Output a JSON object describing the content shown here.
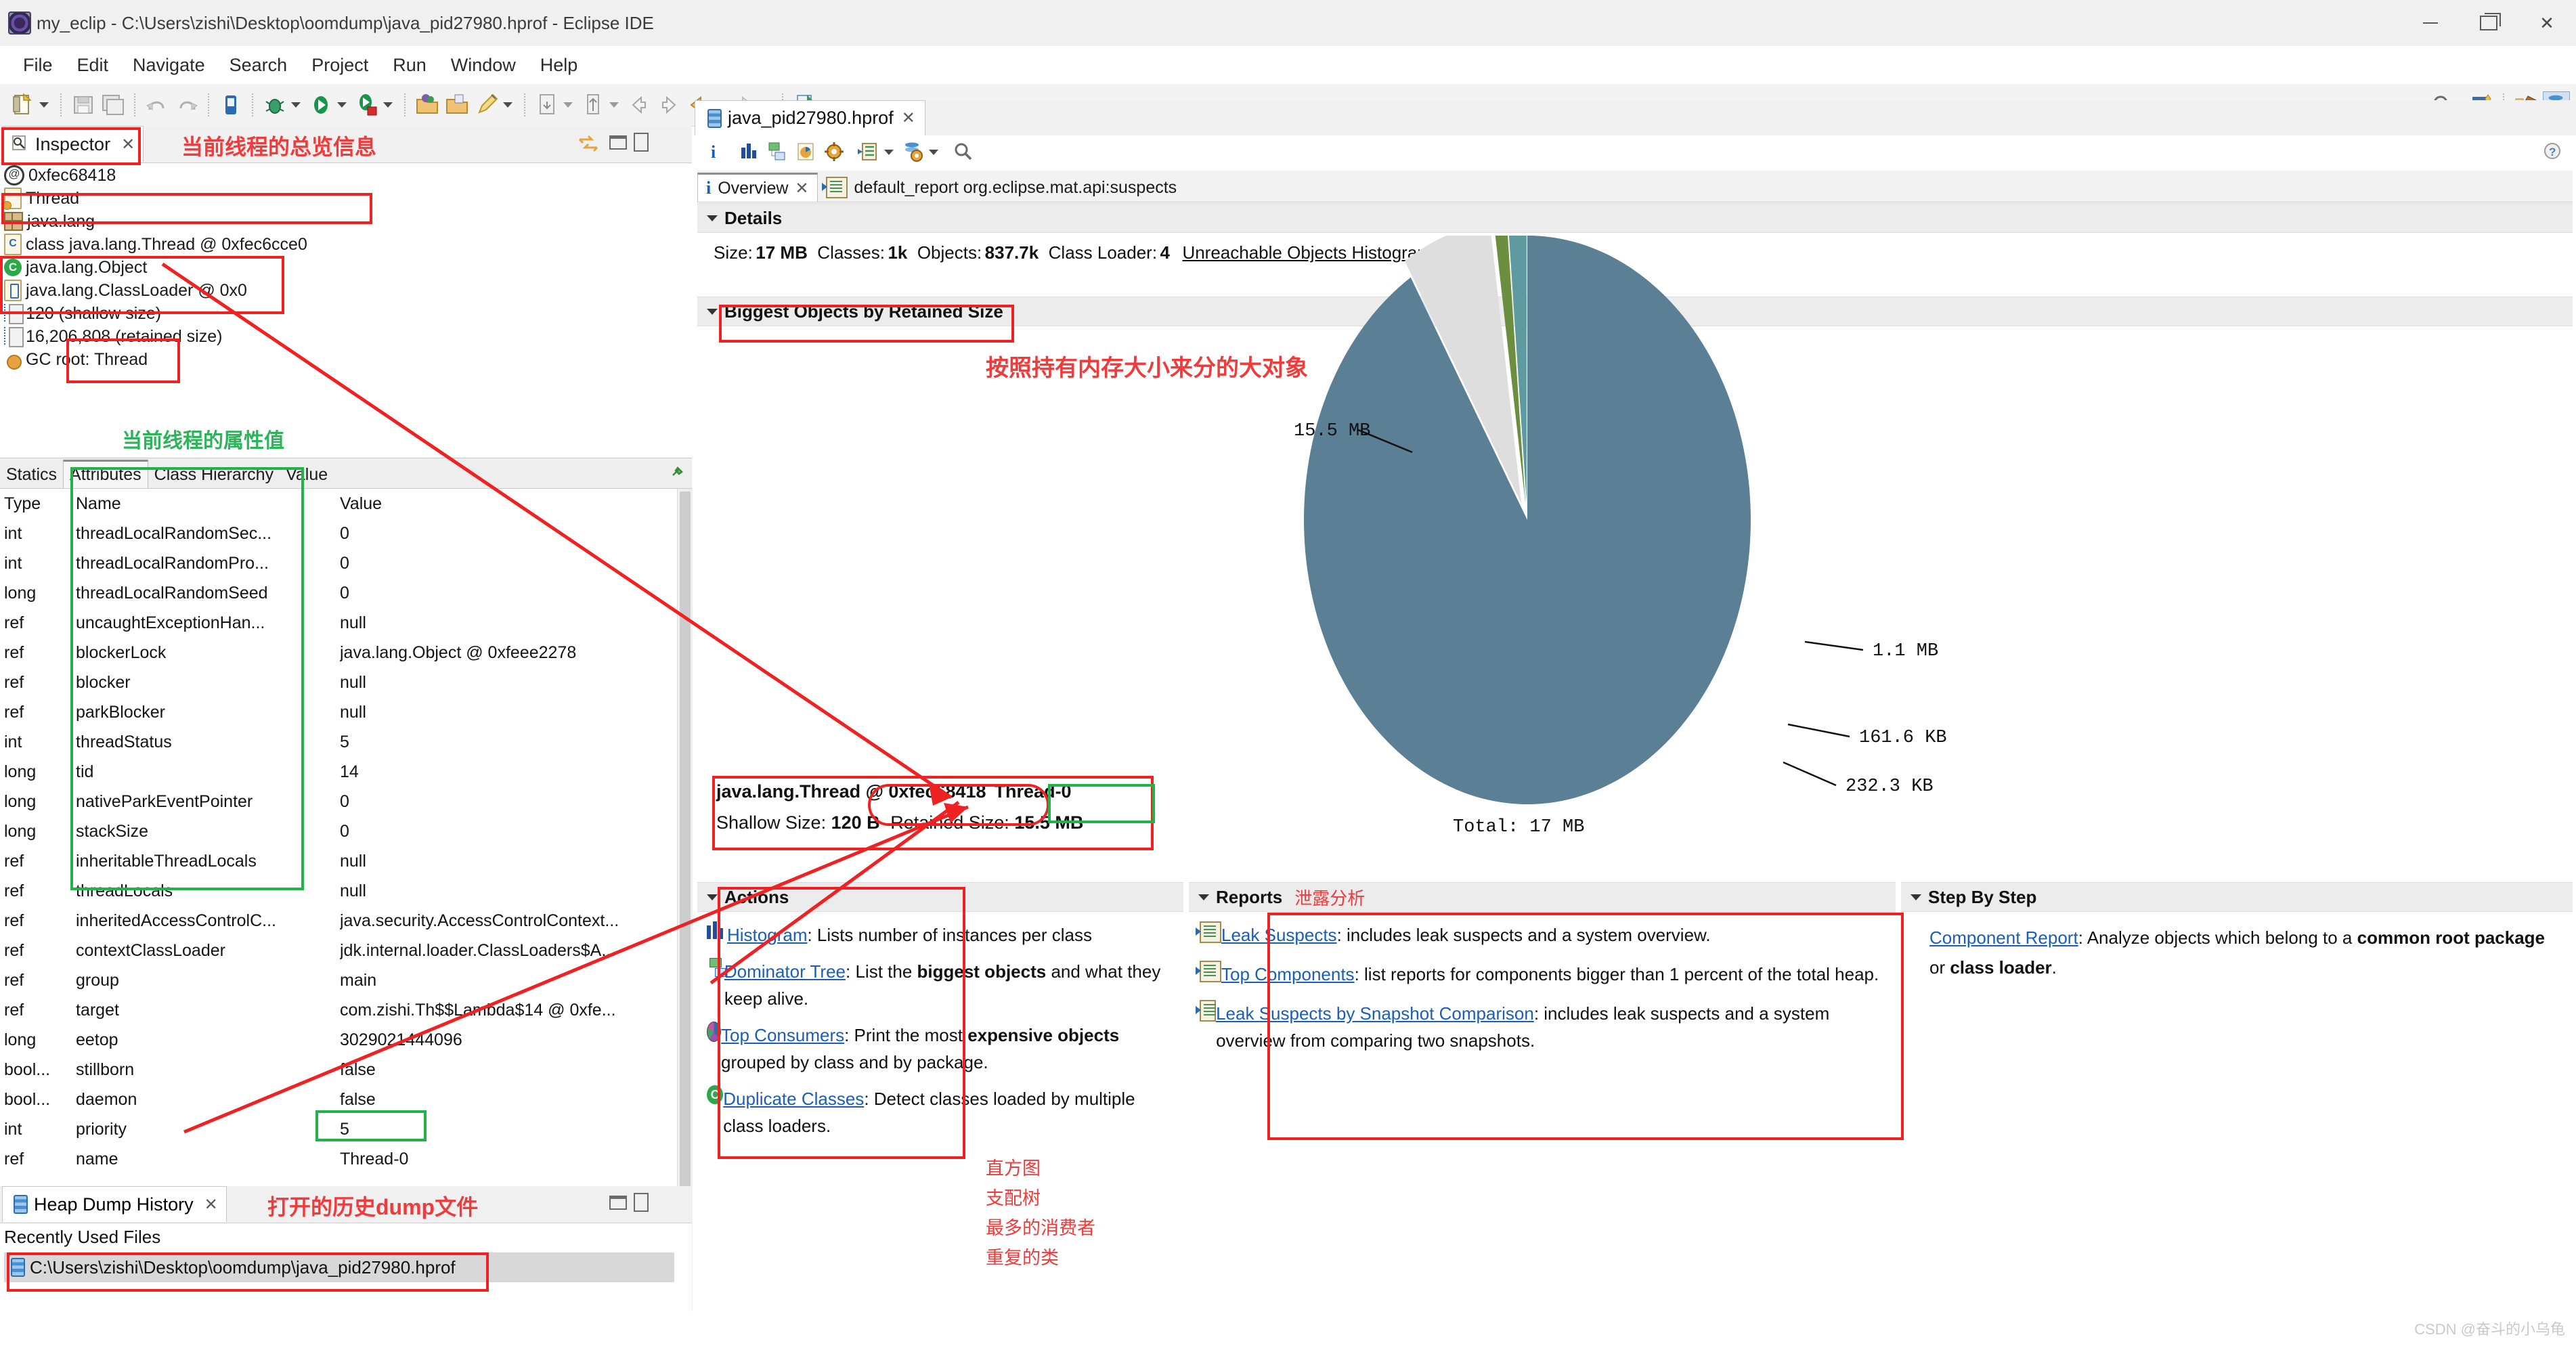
{
  "window": {
    "title": "my_eclip - C:\\Users\\zishi\\Desktop\\oomdump\\java_pid27980.hprof - Eclipse IDE",
    "minimize_label": "–",
    "restore_label": "❐",
    "close_label": "✕"
  },
  "menu": {
    "items": [
      "File",
      "Edit",
      "Navigate",
      "Search",
      "Project",
      "Run",
      "Window",
      "Help"
    ]
  },
  "inspector": {
    "tab_label": "Inspector",
    "tab_close": "✕",
    "annotation": "当前线程的总览信息",
    "rows": [
      {
        "icon": "at-icon",
        "text": "0xfec68418"
      },
      {
        "icon": "thread-icon",
        "text": "Thread"
      },
      {
        "icon": "package-icon",
        "text": "java.lang"
      },
      {
        "icon": "class-icon",
        "text": "class java.lang.Thread @ 0xfec6cce0"
      },
      {
        "icon": "superclass-icon",
        "text": "java.lang.Object"
      },
      {
        "icon": "classloader-icon",
        "text": "java.lang.ClassLoader @ 0x0"
      },
      {
        "icon": "shallow-size-icon",
        "text": "120 (shallow size)"
      },
      {
        "icon": "retained-size-icon",
        "text": "16,206,808 (retained size)"
      },
      {
        "icon": "gc-root-icon",
        "text": "GC root: Thread"
      }
    ],
    "tabs": [
      "Statics",
      "Attributes",
      "Class Hierarchy",
      "Value"
    ],
    "selected_tab": "Attributes",
    "attributes_annotation": "当前线程的属性值",
    "table": {
      "headers": [
        "Type",
        "Name",
        "Value"
      ],
      "rows": [
        [
          "int",
          "threadLocalRandomSec...",
          "0"
        ],
        [
          "int",
          "threadLocalRandomPro...",
          "0"
        ],
        [
          "long",
          "threadLocalRandomSeed",
          "0"
        ],
        [
          "ref",
          "uncaughtExceptionHan...",
          "null"
        ],
        [
          "ref",
          "blockerLock",
          "java.lang.Object @ 0xfeee2278"
        ],
        [
          "ref",
          "blocker",
          "null"
        ],
        [
          "ref",
          "parkBlocker",
          "null"
        ],
        [
          "int",
          "threadStatus",
          "5"
        ],
        [
          "long",
          "tid",
          "14"
        ],
        [
          "long",
          "nativeParkEventPointer",
          "0"
        ],
        [
          "long",
          "stackSize",
          "0"
        ],
        [
          "ref",
          "inheritableThreadLocals",
          "null"
        ],
        [
          "ref",
          "threadLocals",
          "null"
        ],
        [
          "ref",
          "inheritedAccessControlC...",
          "java.security.AccessControlContext..."
        ],
        [
          "ref",
          "contextClassLoader",
          "jdk.internal.loader.ClassLoaders$A..."
        ],
        [
          "ref",
          "group",
          "main"
        ],
        [
          "ref",
          "target",
          "com.zishi.Th$$Lambda$14 @ 0xfe..."
        ],
        [
          "long",
          "eetop",
          "3029021444096"
        ],
        [
          "bool...",
          "stillborn",
          "false"
        ],
        [
          "bool...",
          "daemon",
          "false"
        ],
        [
          "int",
          "priority",
          "5"
        ],
        [
          "ref",
          "name",
          "Thread-0"
        ]
      ]
    }
  },
  "heap_dump_history": {
    "tab_label": "Heap Dump History",
    "tab_close": "✕",
    "annotation": "打开的历史dump文件",
    "section_label": "Recently Used Files",
    "files": [
      "C:\\Users\\zishi\\Desktop\\oomdump\\java_pid27980.hprof"
    ]
  },
  "editor": {
    "tab_label": "java_pid27980.hprof",
    "tab_close": "✕",
    "subtabs": [
      {
        "label": "Overview",
        "icon": "info-icon",
        "selected": true,
        "close": "✕"
      },
      {
        "label": "default_report org.eclipse.mat.api:suspects",
        "icon": "report-icon",
        "selected": false
      }
    ],
    "details": {
      "section_title": "Details",
      "size_label": "Size:",
      "size_value": "17 MB",
      "classes_label": "Classes:",
      "classes_value": "1k",
      "objects_label": "Objects:",
      "objects_value": "837.7k",
      "classloader_label": "Class Loader:",
      "classloader_value": "4",
      "link": "Unreachable Objects Histogram"
    },
    "biggest": {
      "section_title": "Biggest Objects by Retained Size",
      "annotation": "按照持有内存大小来分的大对象",
      "tooltip": {
        "line1_prefix": "java.lang.Thread @ ",
        "line1_address": "0xfec68418",
        "line1_name": "Thread-0",
        "shallow_label": "Shallow Size:",
        "shallow_value": "120 B",
        "retained_label": "Retained Size:",
        "retained_value": "15.5 MB"
      }
    },
    "actions": {
      "section_title": "Actions",
      "annotations": [
        "直方图",
        "支配树",
        "最多的消费者",
        "重复的类"
      ],
      "items": [
        {
          "icon": "histogram-icon",
          "link": "Histogram",
          "desc": ": Lists number of instances per class",
          "bold": []
        },
        {
          "icon": "dominator-tree-icon",
          "link": "Dominator Tree",
          "desc": ": List the biggest objects and what they keep alive.",
          "bold": [
            "biggest objects"
          ]
        },
        {
          "icon": "top-consumers-icon",
          "link": "Top Consumers",
          "desc": ": Print the most expensive objects grouped by class and by package.",
          "bold": [
            "expensive",
            "objects"
          ]
        },
        {
          "icon": "duplicate-classes-icon",
          "link": "Duplicate Classes",
          "desc": ": Detect classes loaded by multiple class loaders.",
          "bold": []
        }
      ]
    },
    "reports": {
      "section_title": "Reports",
      "annotation": "泄露分析",
      "items": [
        {
          "icon": "report-icon",
          "link": "Leak Suspects",
          "desc": ": includes leak suspects and a system overview."
        },
        {
          "icon": "report-icon",
          "link": "Top Components",
          "desc": ": list reports for components bigger than 1 percent of the total heap."
        },
        {
          "icon": "report-icon",
          "link": "Leak Suspects by Snapshot Comparison",
          "desc": ": includes leak suspects and a system overview from comparing two snapshots."
        }
      ]
    },
    "stepbystep": {
      "section_title": "Step By Step",
      "items": [
        {
          "link": "Component Report",
          "desc": ": Analyze objects which belong to a common root package or class loader."
        }
      ]
    }
  },
  "chart_data": {
    "type": "pie",
    "title": "",
    "total_label": "Total: 17 MB",
    "labels": [
      "15.5 MB",
      "1.1 MB",
      "161.6 KB",
      "232.3 KB"
    ],
    "values": [
      15.5,
      1.1,
      0.1578,
      0.2268
    ],
    "units": "MB",
    "colors": [
      "#5b7f94",
      "#dedede",
      "#6b8f3f",
      "#5f9aa0"
    ],
    "exploded": [
      false,
      true,
      true,
      true
    ],
    "legend": "none",
    "grid": false
  },
  "watermark": "CSDN @奋斗的小乌龟"
}
